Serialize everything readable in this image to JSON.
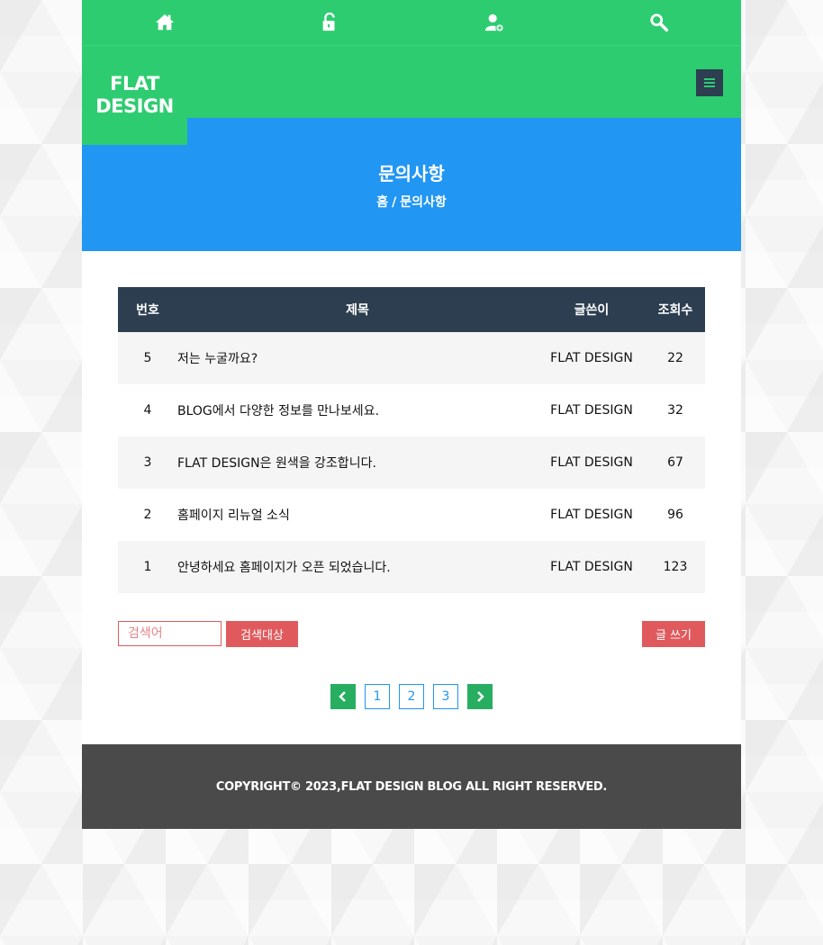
{
  "topnav": {
    "items": [
      {
        "icon": "home-icon"
      },
      {
        "icon": "unlock-icon"
      },
      {
        "icon": "user-add-icon"
      },
      {
        "icon": "search-icon"
      }
    ]
  },
  "header": {
    "logo_line1": "FLAT",
    "logo_line2": "DESIGN",
    "menu_icon": "hamburger-menu-icon"
  },
  "banner": {
    "title": "문의사항",
    "breadcrumb_home": "홈",
    "breadcrumb_sep": "/",
    "breadcrumb_current": "문의사항"
  },
  "board": {
    "headers": {
      "no": "번호",
      "title": "제목",
      "writer": "글쓴이",
      "views": "조회수"
    },
    "rows": [
      {
        "no": "5",
        "title": "저는 누굴까요?",
        "writer": "FLAT DESIGN",
        "views": "22"
      },
      {
        "no": "4",
        "title": "BLOG에서 다양한 정보를 만나보세요.",
        "writer": "FLAT DESIGN",
        "views": "32"
      },
      {
        "no": "3",
        "title": "FLAT DESIGN은 원색을 강조합니다.",
        "writer": "FLAT DESIGN",
        "views": "67"
      },
      {
        "no": "2",
        "title": "홈페이지 리뉴얼 소식",
        "writer": "FLAT DESIGN",
        "views": "96"
      },
      {
        "no": "1",
        "title": "안녕하세요 홈페이지가 오픈 되었습니다.",
        "writer": "FLAT DESIGN",
        "views": "123"
      }
    ]
  },
  "search": {
    "placeholder": "검색어",
    "button_label": "검색대상"
  },
  "write_button_label": "글 쓰기",
  "pagination": {
    "prev_icon": "chevron-left-icon",
    "next_icon": "chevron-right-icon",
    "pages": [
      "1",
      "2",
      "3"
    ]
  },
  "footer": {
    "copyright": "COPYRIGHT© 2023,FLAT DESIGN BLOG ALL RIGHT RESERVED."
  },
  "colors": {
    "green": "#2ecc71",
    "blue": "#2196f3",
    "navy": "#2c3e50",
    "red": "#e05a5d",
    "footer": "#4a4a4a"
  }
}
